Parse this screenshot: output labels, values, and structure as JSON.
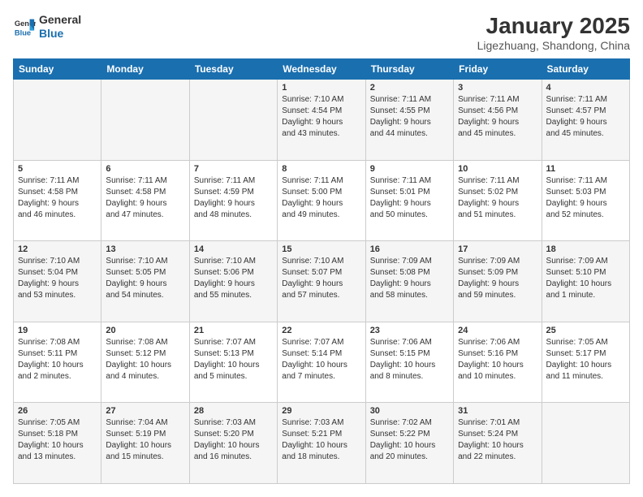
{
  "header": {
    "logo": {
      "line1": "General",
      "line2": "Blue"
    },
    "title": "January 2025",
    "subtitle": "Ligezhuang, Shandong, China"
  },
  "weekdays": [
    "Sunday",
    "Monday",
    "Tuesday",
    "Wednesday",
    "Thursday",
    "Friday",
    "Saturday"
  ],
  "weeks": [
    [
      {
        "day": "",
        "info": ""
      },
      {
        "day": "",
        "info": ""
      },
      {
        "day": "",
        "info": ""
      },
      {
        "day": "1",
        "info": "Sunrise: 7:10 AM\nSunset: 4:54 PM\nDaylight: 9 hours\nand 43 minutes."
      },
      {
        "day": "2",
        "info": "Sunrise: 7:11 AM\nSunset: 4:55 PM\nDaylight: 9 hours\nand 44 minutes."
      },
      {
        "day": "3",
        "info": "Sunrise: 7:11 AM\nSunset: 4:56 PM\nDaylight: 9 hours\nand 45 minutes."
      },
      {
        "day": "4",
        "info": "Sunrise: 7:11 AM\nSunset: 4:57 PM\nDaylight: 9 hours\nand 45 minutes."
      }
    ],
    [
      {
        "day": "5",
        "info": "Sunrise: 7:11 AM\nSunset: 4:58 PM\nDaylight: 9 hours\nand 46 minutes."
      },
      {
        "day": "6",
        "info": "Sunrise: 7:11 AM\nSunset: 4:58 PM\nDaylight: 9 hours\nand 47 minutes."
      },
      {
        "day": "7",
        "info": "Sunrise: 7:11 AM\nSunset: 4:59 PM\nDaylight: 9 hours\nand 48 minutes."
      },
      {
        "day": "8",
        "info": "Sunrise: 7:11 AM\nSunset: 5:00 PM\nDaylight: 9 hours\nand 49 minutes."
      },
      {
        "day": "9",
        "info": "Sunrise: 7:11 AM\nSunset: 5:01 PM\nDaylight: 9 hours\nand 50 minutes."
      },
      {
        "day": "10",
        "info": "Sunrise: 7:11 AM\nSunset: 5:02 PM\nDaylight: 9 hours\nand 51 minutes."
      },
      {
        "day": "11",
        "info": "Sunrise: 7:11 AM\nSunset: 5:03 PM\nDaylight: 9 hours\nand 52 minutes."
      }
    ],
    [
      {
        "day": "12",
        "info": "Sunrise: 7:10 AM\nSunset: 5:04 PM\nDaylight: 9 hours\nand 53 minutes."
      },
      {
        "day": "13",
        "info": "Sunrise: 7:10 AM\nSunset: 5:05 PM\nDaylight: 9 hours\nand 54 minutes."
      },
      {
        "day": "14",
        "info": "Sunrise: 7:10 AM\nSunset: 5:06 PM\nDaylight: 9 hours\nand 55 minutes."
      },
      {
        "day": "15",
        "info": "Sunrise: 7:10 AM\nSunset: 5:07 PM\nDaylight: 9 hours\nand 57 minutes."
      },
      {
        "day": "16",
        "info": "Sunrise: 7:09 AM\nSunset: 5:08 PM\nDaylight: 9 hours\nand 58 minutes."
      },
      {
        "day": "17",
        "info": "Sunrise: 7:09 AM\nSunset: 5:09 PM\nDaylight: 9 hours\nand 59 minutes."
      },
      {
        "day": "18",
        "info": "Sunrise: 7:09 AM\nSunset: 5:10 PM\nDaylight: 10 hours\nand 1 minute."
      }
    ],
    [
      {
        "day": "19",
        "info": "Sunrise: 7:08 AM\nSunset: 5:11 PM\nDaylight: 10 hours\nand 2 minutes."
      },
      {
        "day": "20",
        "info": "Sunrise: 7:08 AM\nSunset: 5:12 PM\nDaylight: 10 hours\nand 4 minutes."
      },
      {
        "day": "21",
        "info": "Sunrise: 7:07 AM\nSunset: 5:13 PM\nDaylight: 10 hours\nand 5 minutes."
      },
      {
        "day": "22",
        "info": "Sunrise: 7:07 AM\nSunset: 5:14 PM\nDaylight: 10 hours\nand 7 minutes."
      },
      {
        "day": "23",
        "info": "Sunrise: 7:06 AM\nSunset: 5:15 PM\nDaylight: 10 hours\nand 8 minutes."
      },
      {
        "day": "24",
        "info": "Sunrise: 7:06 AM\nSunset: 5:16 PM\nDaylight: 10 hours\nand 10 minutes."
      },
      {
        "day": "25",
        "info": "Sunrise: 7:05 AM\nSunset: 5:17 PM\nDaylight: 10 hours\nand 11 minutes."
      }
    ],
    [
      {
        "day": "26",
        "info": "Sunrise: 7:05 AM\nSunset: 5:18 PM\nDaylight: 10 hours\nand 13 minutes."
      },
      {
        "day": "27",
        "info": "Sunrise: 7:04 AM\nSunset: 5:19 PM\nDaylight: 10 hours\nand 15 minutes."
      },
      {
        "day": "28",
        "info": "Sunrise: 7:03 AM\nSunset: 5:20 PM\nDaylight: 10 hours\nand 16 minutes."
      },
      {
        "day": "29",
        "info": "Sunrise: 7:03 AM\nSunset: 5:21 PM\nDaylight: 10 hours\nand 18 minutes."
      },
      {
        "day": "30",
        "info": "Sunrise: 7:02 AM\nSunset: 5:22 PM\nDaylight: 10 hours\nand 20 minutes."
      },
      {
        "day": "31",
        "info": "Sunrise: 7:01 AM\nSunset: 5:24 PM\nDaylight: 10 hours\nand 22 minutes."
      },
      {
        "day": "",
        "info": ""
      }
    ]
  ]
}
